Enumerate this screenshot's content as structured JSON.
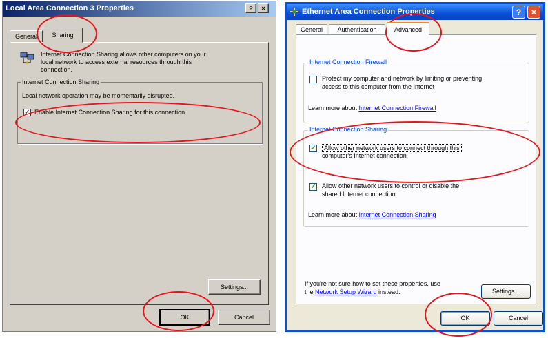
{
  "left": {
    "title": "Local Area Connection 3 Properties",
    "title_buttons": {
      "help": "?",
      "close": "×"
    },
    "tabs": [
      "General",
      "Sharing"
    ],
    "description_lines": [
      "Internet Connection Sharing allows other computers on your",
      "local network to access external resources through this",
      "connection."
    ],
    "group_title": "Internet Connection Sharing",
    "group_note": "Local network operation may be momentarily disrupted.",
    "enable_checkbox": {
      "checked": "✓",
      "label": "Enable Internet Connection Sharing for this connection"
    },
    "settings_label": "Settings...",
    "ok_label": "OK",
    "cancel_label": "Cancel"
  },
  "right": {
    "title": "Ethernet Area Connection Properties",
    "title_buttons": {
      "help": "?",
      "close": "×"
    },
    "tabs": [
      "General",
      "Authentication",
      "Advanced"
    ],
    "firewall_group": {
      "title": "Internet Connection Firewall",
      "checkbox_line1": "Protect my computer and network by limiting or preventing",
      "checkbox_line2": "access to this computer from the Internet",
      "learn_prefix": "Learn more about ",
      "learn_link": "Internet Connection Firewall"
    },
    "ics_group": {
      "title": "Internet Connection Sharing",
      "allow_connect_line1": "Allow other network users to connect through this",
      "allow_connect_line2": "computer's Internet connection",
      "allow_control_line1": "Allow other network users to control or disable the",
      "allow_control_line2": "shared Internet connection",
      "checked_mark": "✓",
      "learn_prefix": "Learn more about ",
      "learn_link": "Internet Connection Sharing"
    },
    "footer_line1": "If you're not sure how to set these properties, use",
    "footer_prefix": "the ",
    "footer_link": "Network Setup Wizard",
    "footer_suffix": " instead.",
    "settings_label": "Settings...",
    "ok_label": "OK",
    "cancel_label": "Cancel"
  },
  "annotation_color": "#e8141b"
}
